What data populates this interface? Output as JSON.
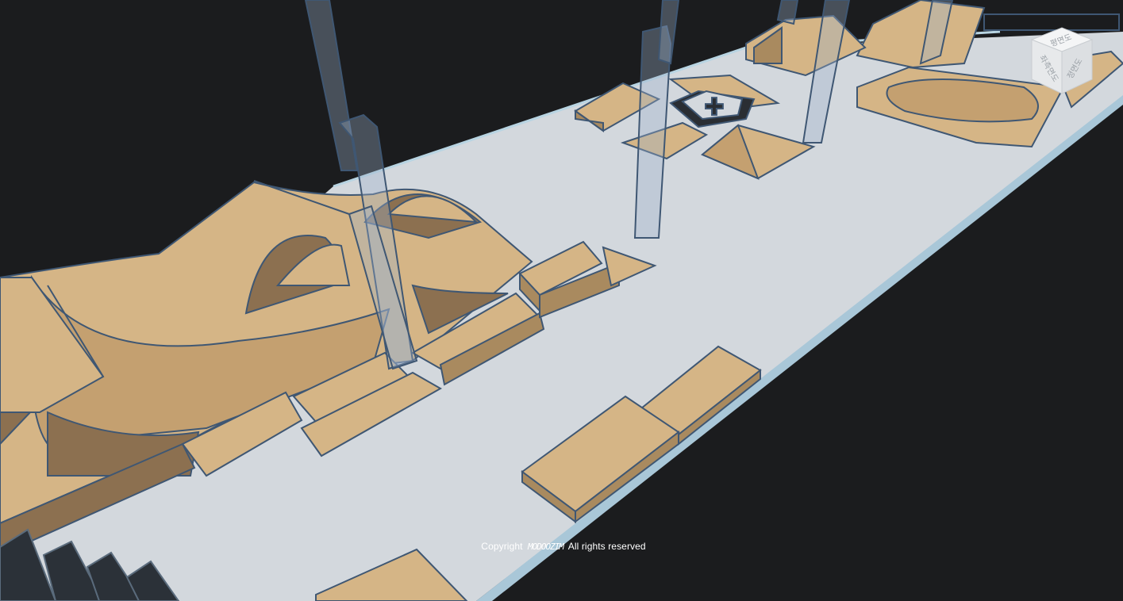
{
  "viewer": {
    "copyright_prefix": "Copyright",
    "copyright_brand": "MODOOZIM",
    "copyright_suffix": "All rights reserved"
  },
  "viewcube": {
    "top_label": "평면도",
    "left_label": "좌측면도",
    "right_label": "정면도"
  },
  "colors": {
    "background": "#1b1c1e",
    "floor": "#d4d9de",
    "ramp": "#d5b586",
    "ramp_shadow": "#8c7050",
    "glass_column": "#9fb3cc",
    "outline": "#3f5773"
  }
}
